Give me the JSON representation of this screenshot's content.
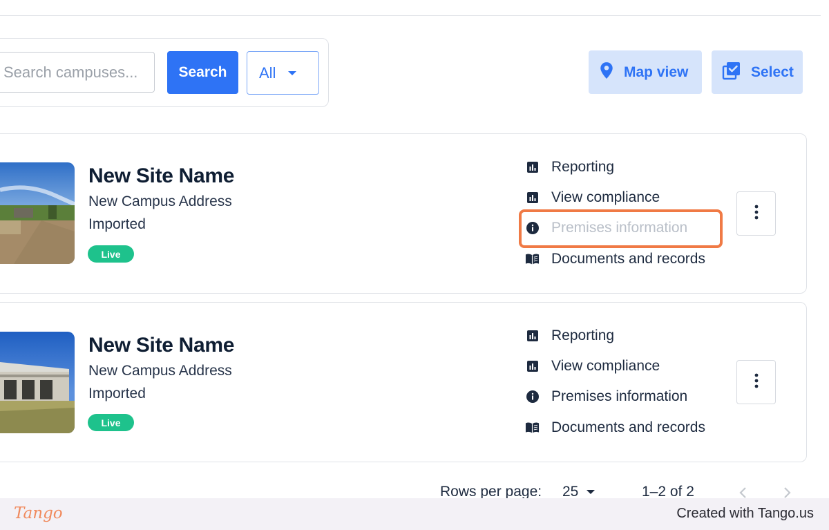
{
  "search": {
    "placeholder": "Search campuses...",
    "button_label": "Search",
    "filter_value": "All"
  },
  "toolbar": {
    "map_view_label": "Map view",
    "select_label": "Select"
  },
  "sites": [
    {
      "name": "New Site Name",
      "address": "New Campus Address",
      "source": "Imported",
      "status": "Live",
      "actions": {
        "reporting": "Reporting",
        "view_compliance": "View compliance",
        "premises_information": "Premises information",
        "documents_records": "Documents and records"
      }
    },
    {
      "name": "New Site Name",
      "address": "New Campus Address",
      "source": "Imported",
      "status": "Live",
      "actions": {
        "reporting": "Reporting",
        "view_compliance": "View compliance",
        "premises_information": "Premises information",
        "documents_records": "Documents and records"
      }
    }
  ],
  "pagination": {
    "rows_per_page_label": "Rows per page:",
    "rows_per_page_value": "25",
    "range_text": "1–2 of 2"
  },
  "footer": {
    "logo_text": "Tango",
    "credit_text": "Created with Tango.us"
  },
  "colors": {
    "primary": "#2e73f5",
    "primary_soft": "#d6e4fb",
    "live_badge": "#1ec28c",
    "highlight": "#f07a45"
  }
}
